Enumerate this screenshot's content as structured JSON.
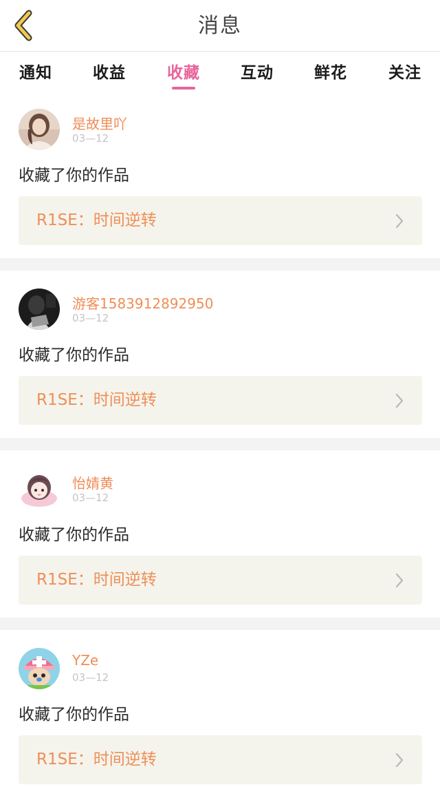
{
  "header": {
    "title": "消息",
    "back_icon": "chevron-left-icon",
    "accent_color": "#f2c94c"
  },
  "tabs": [
    {
      "label": "通知",
      "active": false
    },
    {
      "label": "收益",
      "active": false
    },
    {
      "label": "收藏",
      "active": true
    },
    {
      "label": "互动",
      "active": false
    },
    {
      "label": "鲜花",
      "active": false
    },
    {
      "label": "关注",
      "active": false
    }
  ],
  "colors": {
    "active_tab": "#e8649a",
    "username": "#ef8e58",
    "work_title": "#ef8e58",
    "work_bg": "#f4f4ec"
  },
  "items": [
    {
      "username": "是故里吖",
      "date": "03—12",
      "action": "收藏了你的作品",
      "work_title": "R1SE：时间逆转",
      "avatar": "user-avatar-photo"
    },
    {
      "username": "游客1583912892950",
      "date": "03—12",
      "action": "收藏了你的作品",
      "work_title": "R1SE：时间逆转",
      "avatar": "user-avatar-dark-photo"
    },
    {
      "username": "怡婧黄",
      "date": "03—12",
      "action": "收藏了你的作品",
      "work_title": "R1SE：时间逆转",
      "avatar": "user-avatar-anime"
    },
    {
      "username": "YZe",
      "date": "03—12",
      "action": "收藏了你的作品",
      "work_title": "R1SE：时间逆转",
      "avatar": "user-avatar-cartoon"
    }
  ]
}
